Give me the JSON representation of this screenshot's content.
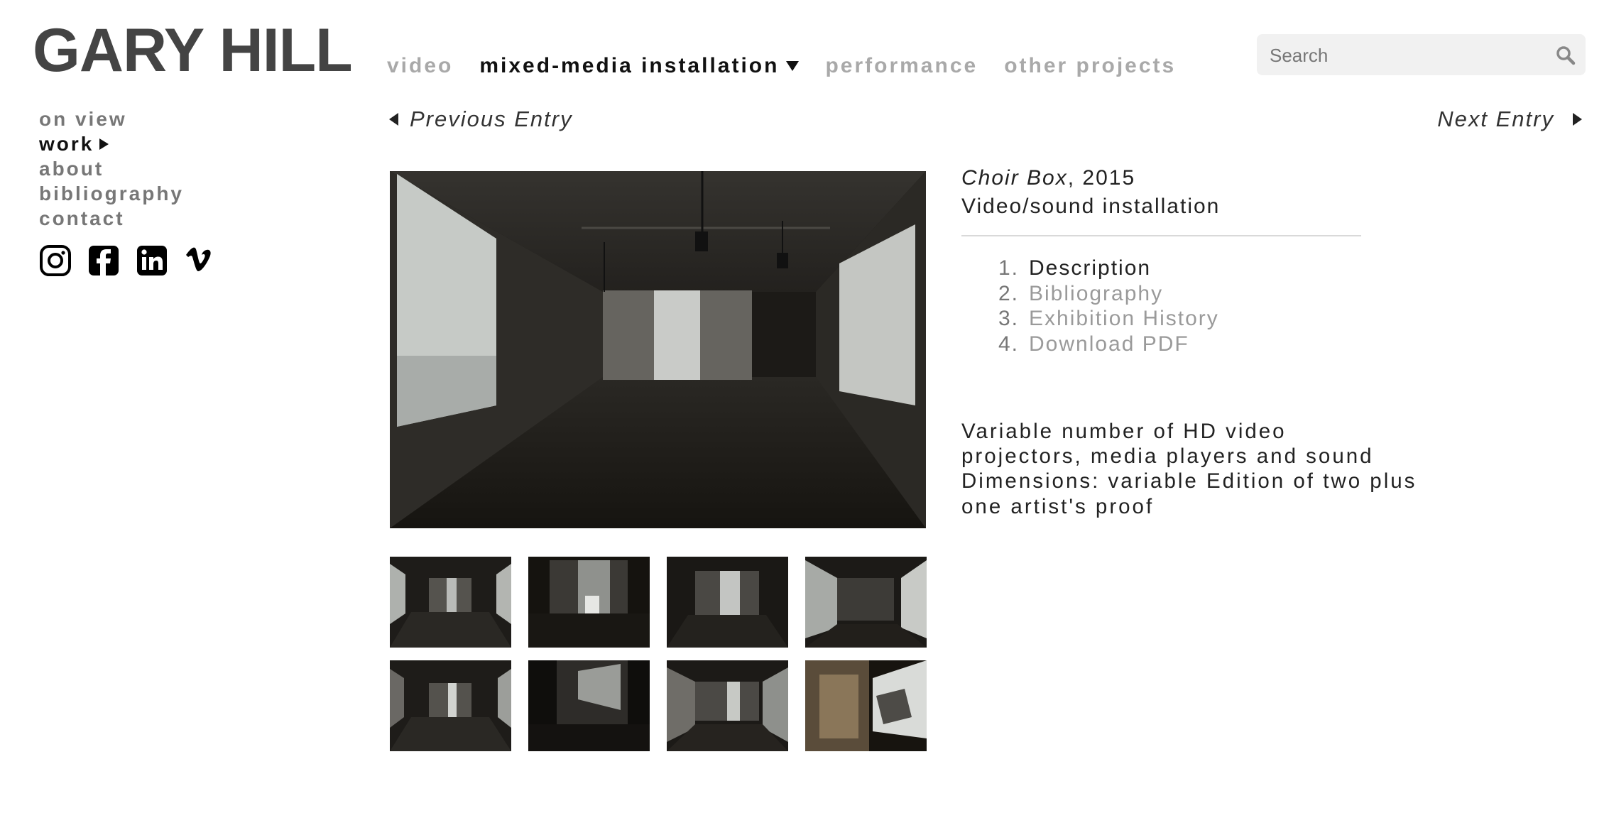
{
  "brand": {
    "logo_text": "GARY HILL"
  },
  "top_nav": {
    "items": [
      {
        "label": "video"
      },
      {
        "label": "mixed-media installation",
        "active": true
      },
      {
        "label": "performance"
      },
      {
        "label": "other projects"
      }
    ]
  },
  "search": {
    "placeholder": "Search",
    "value": ""
  },
  "side_nav": {
    "items": [
      {
        "label": "on view"
      },
      {
        "label": "work",
        "active": true
      },
      {
        "label": "about"
      },
      {
        "label": "bibliography"
      },
      {
        "label": "contact"
      }
    ],
    "social": [
      "instagram-icon",
      "facebook-icon",
      "linkedin-icon",
      "vimeo-icon"
    ]
  },
  "entry_nav": {
    "previous": "Previous Entry",
    "next": "Next Entry"
  },
  "work": {
    "title": "Choir Box",
    "year_suffix": ", 2015",
    "medium": "Video/sound installation",
    "tabs": [
      {
        "num": "1.",
        "label": "Description",
        "active": true
      },
      {
        "num": "2.",
        "label": "Bibliography"
      },
      {
        "num": "3.",
        "label": "Exhibition History"
      },
      {
        "num": "4.",
        "label": "Download PDF"
      }
    ],
    "description_lines": [
      "Variable number of HD video",
      "projectors, media players and sound",
      "Dimensions: variable Edition of two plus",
      "one artist's proof"
    ]
  },
  "colors": {
    "logo": "#444444",
    "nav_inactive": "#a9a9a9",
    "nav_active": "#111111",
    "sidenav_inactive": "#777777",
    "search_bg": "#f1f1f1"
  },
  "gallery": {
    "thumbnail_count": 8
  }
}
